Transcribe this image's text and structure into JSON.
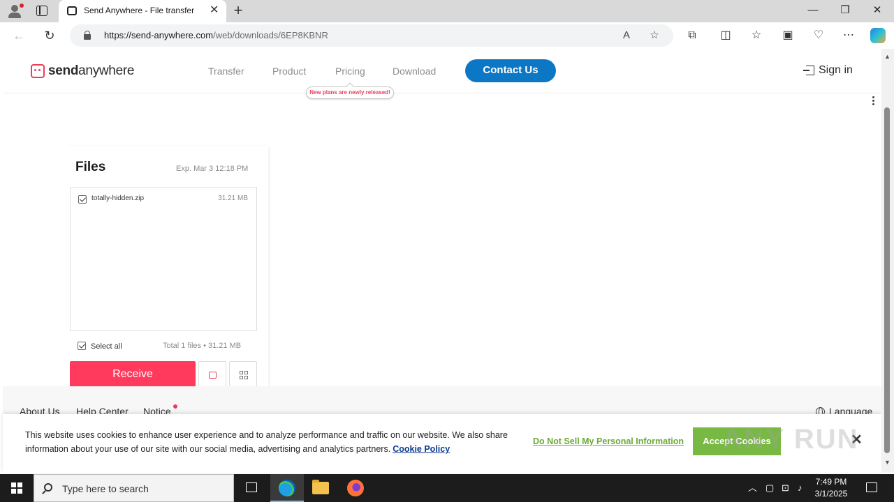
{
  "browser": {
    "tab_title": "Send Anywhere - File transfer",
    "tab_close": "✕",
    "new_tab": "+",
    "url_host": "https://send-anywhere.com",
    "url_path": "/web/downloads/6EP8KBNR",
    "icons": [
      "profile-icon",
      "tab-actions-icon",
      "back-icon",
      "refresh-icon",
      "lock-icon",
      "read-aloud-icon",
      "favorite-star-icon",
      "extensions-icon",
      "split-screen-icon",
      "favorites-icon",
      "collections-icon",
      "browser-essentials-icon",
      "more-icon",
      "copilot-icon"
    ]
  },
  "site": {
    "logo": {
      "brand_bold": "send",
      "brand_rest": "anywhere"
    },
    "nav": [
      {
        "label": "Transfer"
      },
      {
        "label": "Product"
      },
      {
        "label": "Pricing"
      },
      {
        "label": "Download"
      }
    ],
    "pricing_badge": "New plans are newly released!",
    "contact_label": "Contact Us",
    "signin_label": "Sign in",
    "accent_color": "#ef3b5a",
    "contact_color": "#0b77c5"
  },
  "files": {
    "title": "Files",
    "expires": "Exp. Mar 3 12:18 PM",
    "items": [
      {
        "name": "totally-hidden.zip",
        "size": "31.21 MB",
        "checked": true
      }
    ],
    "select_all_label": "Select all",
    "total": "Total 1 files • 31.21 MB",
    "receive_label": "Receive",
    "receive_color": "#ff3a5c"
  },
  "footer": {
    "links": [
      {
        "label": "About Us"
      },
      {
        "label": "Help Center"
      },
      {
        "label": "Notice"
      }
    ],
    "language_label": "Language"
  },
  "cookie": {
    "text": "This website uses cookies to enhance user experience and to analyze performance and traffic on our website. We also share information about your use of our site with our social media, advertising and analytics partners.",
    "policy_link": "Cookie Policy",
    "do_not_sell": "Do Not Sell My Personal Information",
    "accept_label": "Accept Cookies",
    "accept_color": "#78b943"
  },
  "watermark": "ANY RUN",
  "taskbar": {
    "search_placeholder": "Type here to search",
    "time": "7:49 PM",
    "date": "3/1/2025"
  }
}
